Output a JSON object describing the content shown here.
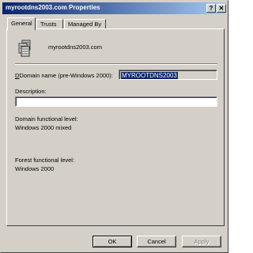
{
  "window": {
    "title": "myrootdns2003.com Properties",
    "help_glyph": "?",
    "close_glyph": "✕"
  },
  "tabs": [
    {
      "label": "General",
      "active": true
    },
    {
      "label": "Trusts",
      "active": false
    },
    {
      "label": "Managed By",
      "active": false
    }
  ],
  "general": {
    "domain_name": "myrootdns2003.com",
    "pre2000_label": "Domain name (pre-Windows 2000):",
    "pre2000_value": "MYROOTDNS2003",
    "description_label": "Description:",
    "description_value": "",
    "domain_level_label": "Domain functional level:",
    "domain_level_value": "Windows 2000 mixed",
    "forest_level_label": "Forest functional level:",
    "forest_level_value": "Windows 2000"
  },
  "buttons": {
    "ok": "OK",
    "cancel": "Cancel",
    "apply": "Apply"
  },
  "colors": {
    "title_bar_start": "#0a246a",
    "title_bar_end": "#a6caf0",
    "dialog_face": "#d4d0c8",
    "selection": "#0a246a"
  },
  "icons": {
    "domain": "domain-servers-icon"
  }
}
